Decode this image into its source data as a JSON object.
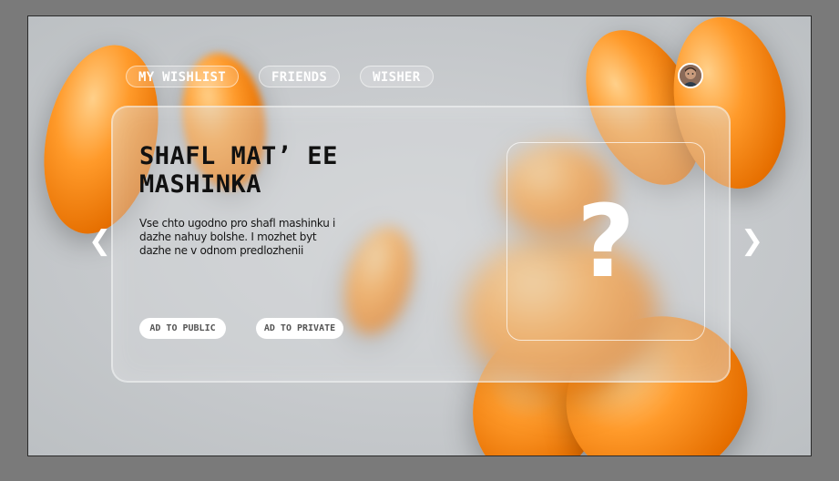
{
  "nav": {
    "items": [
      {
        "label": "MY WISHLIST"
      },
      {
        "label": "FRIENDS"
      },
      {
        "label": "WISHER"
      }
    ]
  },
  "profile": {
    "icon": "avatar-photo"
  },
  "card": {
    "title": "SHAFL MAT’ EE MASHINKA",
    "description": "Vse chto ugodno pro shafl mashinku i dazhe nahuy bolshe. I mozhet byt dazhe ne v odnom predlozhenii",
    "public_button": "AD TO PUBLIC",
    "private_button": "AD TO PRIVATE",
    "image_placeholder": "?"
  },
  "carousel": {
    "prev": "❮",
    "next": "❯"
  },
  "colors": {
    "accent": "#ff9a2a",
    "background": "#c6c9cc",
    "text": "#111111"
  }
}
